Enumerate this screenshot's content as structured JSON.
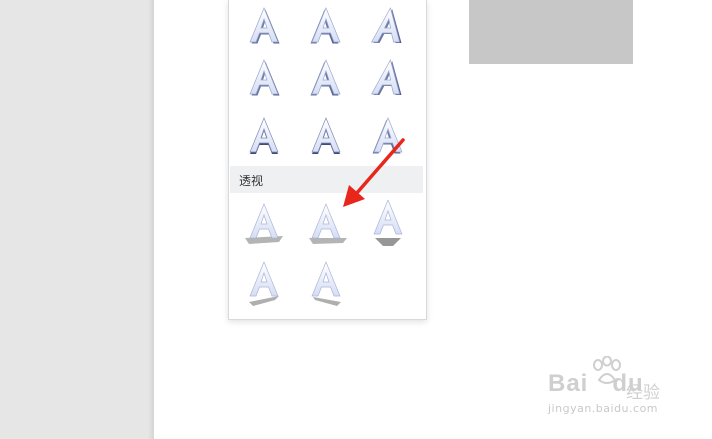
{
  "section": {
    "label": "透视"
  },
  "tiles": [
    {
      "glyph": "A",
      "style": "3d-rotation"
    },
    {
      "glyph": "A",
      "style": "3d-rotation"
    },
    {
      "glyph": "A",
      "style": "3d-rotation"
    },
    {
      "glyph": "A",
      "style": "3d-rotation"
    },
    {
      "glyph": "A",
      "style": "3d-rotation"
    },
    {
      "glyph": "A",
      "style": "3d-rotation"
    },
    {
      "glyph": "A",
      "style": "3d-rotation"
    },
    {
      "glyph": "A",
      "style": "3d-rotation"
    },
    {
      "glyph": "A",
      "style": "3d-rotation"
    },
    {
      "glyph": "A",
      "style": "perspective"
    },
    {
      "glyph": "A",
      "style": "perspective"
    },
    {
      "glyph": "A",
      "style": "perspective"
    },
    {
      "glyph": "A",
      "style": "perspective"
    },
    {
      "glyph": "A",
      "style": "perspective"
    }
  ],
  "watermark": {
    "brand": "Bai",
    "brand_tail": "du",
    "jingyan": "经验",
    "url": "jingyan.baidu.com"
  },
  "colors": {
    "arrow": "#e8261c",
    "glyph_light": "#e8eefc",
    "glyph_dark": "#6a79a8",
    "section_bg": "#eff0f2",
    "gray_block": "#c7c7c7"
  }
}
